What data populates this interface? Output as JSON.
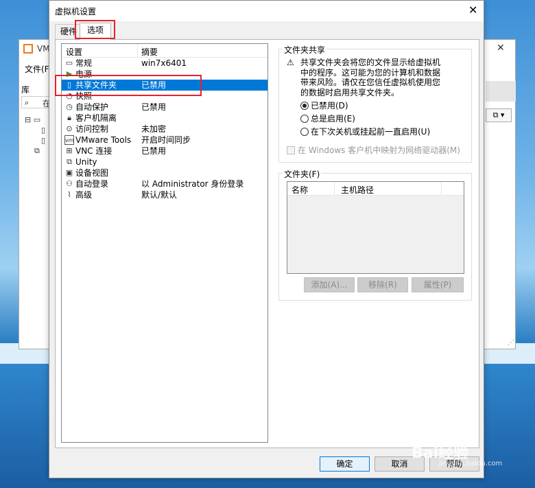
{
  "background_window": {
    "title": "VM",
    "menu": "文件(F",
    "library_label": "库",
    "search_text": "在",
    "close_glyph": "✕"
  },
  "dialog": {
    "title": "虚拟机设置",
    "close_glyph": "✕",
    "tabs": [
      {
        "label": "硬件"
      },
      {
        "label": "选项"
      }
    ]
  },
  "settings_list": {
    "headers": {
      "setting": "设置",
      "summary": "摘要"
    },
    "rows": [
      {
        "label": "常规",
        "summary": "win7x6401",
        "icon": "general-icon"
      },
      {
        "label": "电源",
        "summary": "",
        "icon": "power-icon"
      },
      {
        "label": "共享文件夹",
        "summary": "已禁用",
        "icon": "shared-folder-icon",
        "selected": true
      },
      {
        "label": "快照",
        "summary": "",
        "icon": "snapshot-icon"
      },
      {
        "label": "自动保护",
        "summary": "已禁用",
        "icon": "autoprotect-icon"
      },
      {
        "label": "客户机隔离",
        "summary": "",
        "icon": "lock-icon"
      },
      {
        "label": "访问控制",
        "summary": "未加密",
        "icon": "access-control-icon"
      },
      {
        "label": "VMware Tools",
        "summary": "开启时间同步",
        "icon": "vmware-tools-icon"
      },
      {
        "label": "VNC 连接",
        "summary": "已禁用",
        "icon": "vnc-icon"
      },
      {
        "label": "Unity",
        "summary": "",
        "icon": "unity-icon"
      },
      {
        "label": "设备视图",
        "summary": "",
        "icon": "device-view-icon"
      },
      {
        "label": "自动登录",
        "summary": "以 Administrator 身份登录",
        "icon": "autologin-icon"
      },
      {
        "label": "高级",
        "summary": "默认/默认",
        "icon": "advanced-icon"
      }
    ]
  },
  "folder_sharing": {
    "title": "文件夹共享",
    "warning": "共享文件夹会将您的文件显示给虚拟机中的程序。这可能为您的计算机和数据带来风险。请仅在您信任虚拟机使用您的数据时启用共享文件夹。",
    "options": [
      {
        "label": "已禁用(D)",
        "checked": true
      },
      {
        "label": "总是启用(E)",
        "checked": false
      },
      {
        "label": "在下次关机或挂起前一直启用(U)",
        "checked": false
      }
    ],
    "map_drive_label": "在 Windows 客户机中映射为网络驱动器(M)"
  },
  "folders": {
    "title": "文件夹(F)",
    "columns": [
      "名称",
      "主机路径"
    ],
    "buttons": {
      "add": "添加(A)...",
      "remove": "移除(R)",
      "properties": "属性(P)"
    }
  },
  "footer": {
    "ok": "确定",
    "cancel": "取消",
    "help": "帮助"
  },
  "watermark": {
    "text": "Bai经验",
    "sub": "jingyan.baidu.com"
  },
  "colors": {
    "selection": "#0078d7",
    "highlight_box": "#e8202a",
    "desktop": "#3d8fd6"
  }
}
